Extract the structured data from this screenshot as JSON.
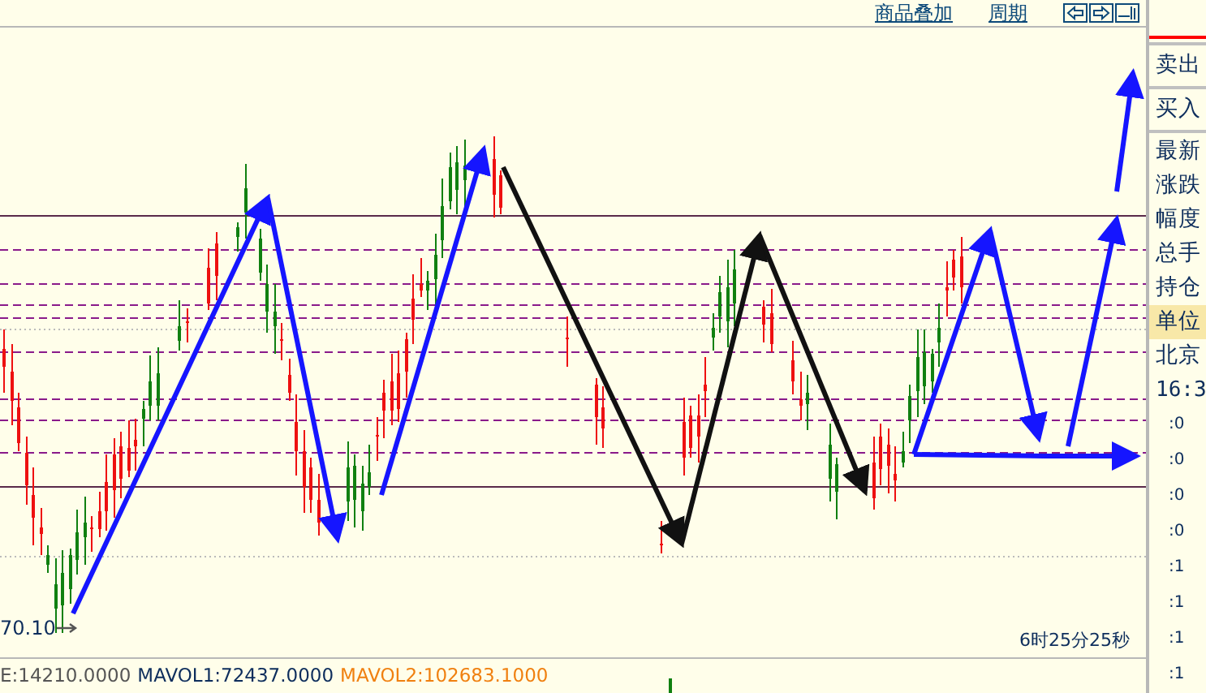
{
  "toolbar": {
    "links": [
      "商品叠加",
      "周期"
    ]
  },
  "chart": {
    "low_label": "70.10",
    "countdown": "6时25分25秒"
  },
  "indicator": {
    "items": [
      {
        "text": "E:14210.0000",
        "kind": "vol"
      },
      {
        "text": "MAVOL1:72437.0000",
        "kind": "ma1"
      },
      {
        "text": "MAVOL2:102683.1000",
        "kind": "ma2"
      }
    ]
  },
  "side_panel": {
    "buttons": [
      "卖出",
      "买入"
    ],
    "fields": [
      {
        "label": "最新",
        "selected": false
      },
      {
        "label": "涨跌",
        "selected": false
      },
      {
        "label": "幅度",
        "selected": false
      },
      {
        "label": "总手",
        "selected": false
      },
      {
        "label": "持仓",
        "selected": false
      },
      {
        "label": "单位",
        "selected": true
      }
    ],
    "market": "北京",
    "time": "16:3",
    "scale": [
      ":0",
      ":0",
      ":0",
      ":0",
      ":1",
      ":1",
      ":1",
      ":1"
    ]
  }
}
